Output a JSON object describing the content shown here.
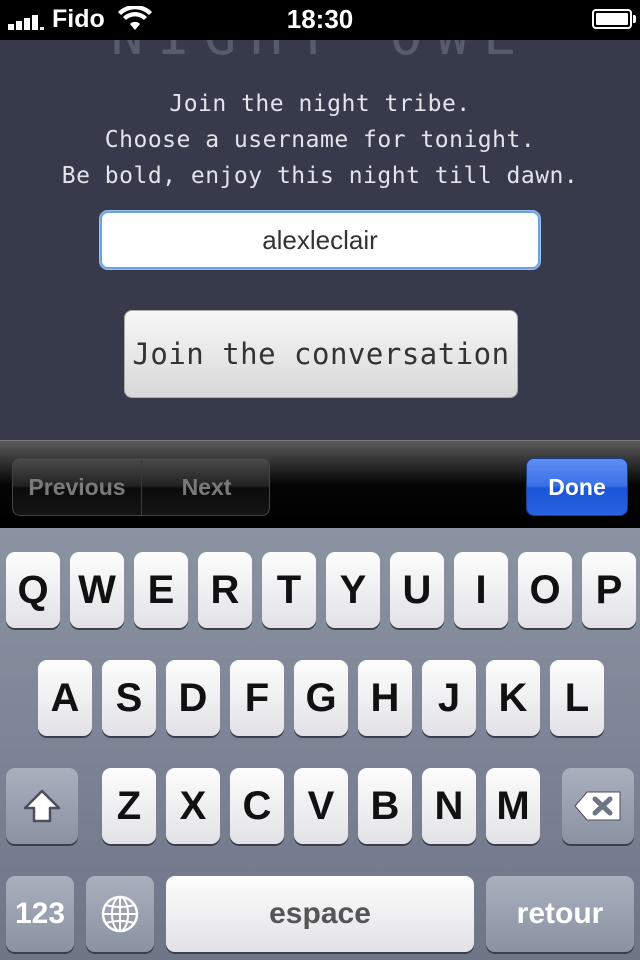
{
  "status_bar": {
    "carrier": "Fido",
    "time": "18:30",
    "battery_level": 1.0,
    "signal_bars": 4
  },
  "intro": {
    "line1": "Join the night tribe.",
    "line2": "Choose a username for tonight.",
    "line3": "Be bold, enjoy this night till dawn."
  },
  "form": {
    "username_value": "alexleclair",
    "join_label": "Join the conversation"
  },
  "accessory_bar": {
    "previous_label": "Previous",
    "next_label": "Next",
    "done_label": "Done"
  },
  "keyboard": {
    "row1": [
      "Q",
      "W",
      "E",
      "R",
      "T",
      "Y",
      "U",
      "I",
      "O",
      "P"
    ],
    "row2": [
      "A",
      "S",
      "D",
      "F",
      "G",
      "H",
      "J",
      "K",
      "L"
    ],
    "row3": [
      "Z",
      "X",
      "C",
      "V",
      "B",
      "N",
      "M"
    ],
    "numbers_label": "123",
    "space_label": "espace",
    "return_label": "retour",
    "shift_icon": "shift-icon",
    "delete_icon": "delete-icon",
    "globe_icon": "globe-icon"
  },
  "colors": {
    "background": "#363a4a",
    "done_blue": "#2a62df",
    "field_border": "#6da2e2"
  }
}
